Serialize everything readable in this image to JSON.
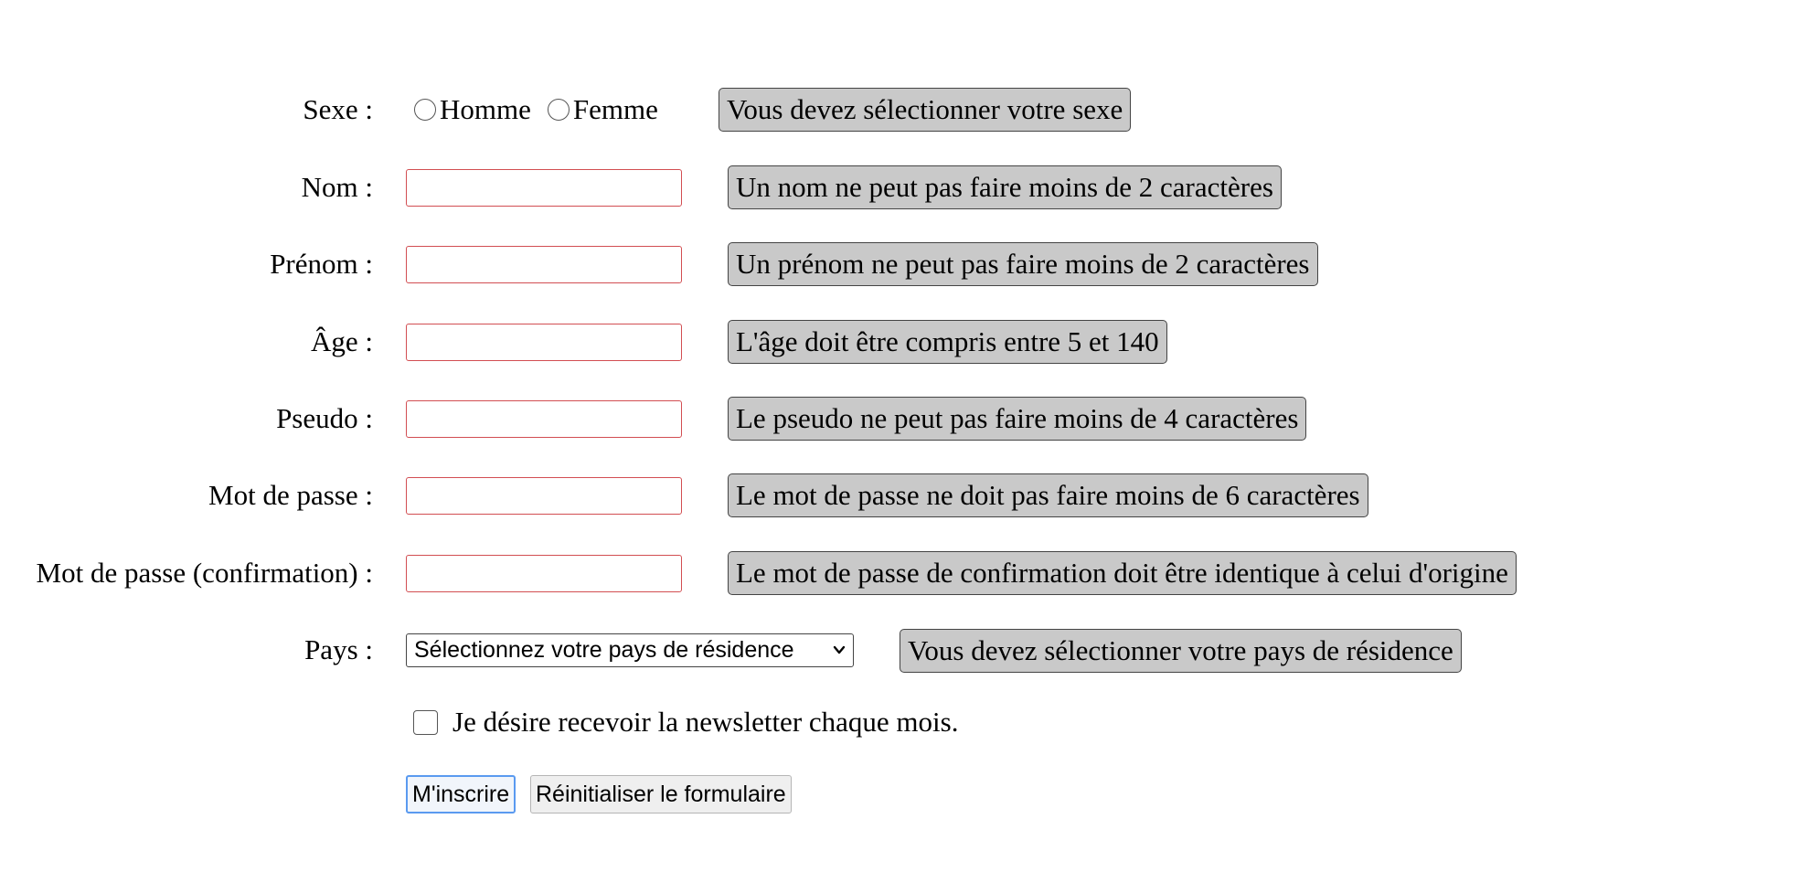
{
  "form": {
    "sexe": {
      "label": "Sexe :",
      "options": [
        "Homme",
        "Femme"
      ],
      "error": "Vous devez sélectionner votre sexe"
    },
    "nom": {
      "label": "Nom :",
      "value": "",
      "error": "Un nom ne peut pas faire moins de 2 caractères"
    },
    "prenom": {
      "label": "Prénom :",
      "value": "",
      "error": "Un prénom ne peut pas faire moins de 2 caractères"
    },
    "age": {
      "label": "Âge :",
      "value": "",
      "error": "L'âge doit être compris entre 5 et 140"
    },
    "pseudo": {
      "label": "Pseudo :",
      "value": "",
      "error": "Le pseudo ne peut pas faire moins de 4 caractères"
    },
    "mdp": {
      "label": "Mot de passe :",
      "value": "",
      "error": "Le mot de passe ne doit pas faire moins de 6 caractères"
    },
    "mdp_confirm": {
      "label": "Mot de passe (confirmation) :",
      "value": "",
      "error": "Le mot de passe de confirmation doit être identique à celui d'origine"
    },
    "pays": {
      "label": "Pays :",
      "selected": "Sélectionnez votre pays de résidence",
      "error": "Vous devez sélectionner votre pays de résidence"
    },
    "newsletter": {
      "label": "Je désire recevoir la newsletter chaque mois."
    },
    "buttons": {
      "submit": "M'inscrire",
      "reset": "Réinitialiser le formulaire"
    }
  },
  "colors": {
    "invalid_border": "#d24e52",
    "error_bg": "#c9c9c9",
    "focus_ring": "#5a9af0"
  }
}
